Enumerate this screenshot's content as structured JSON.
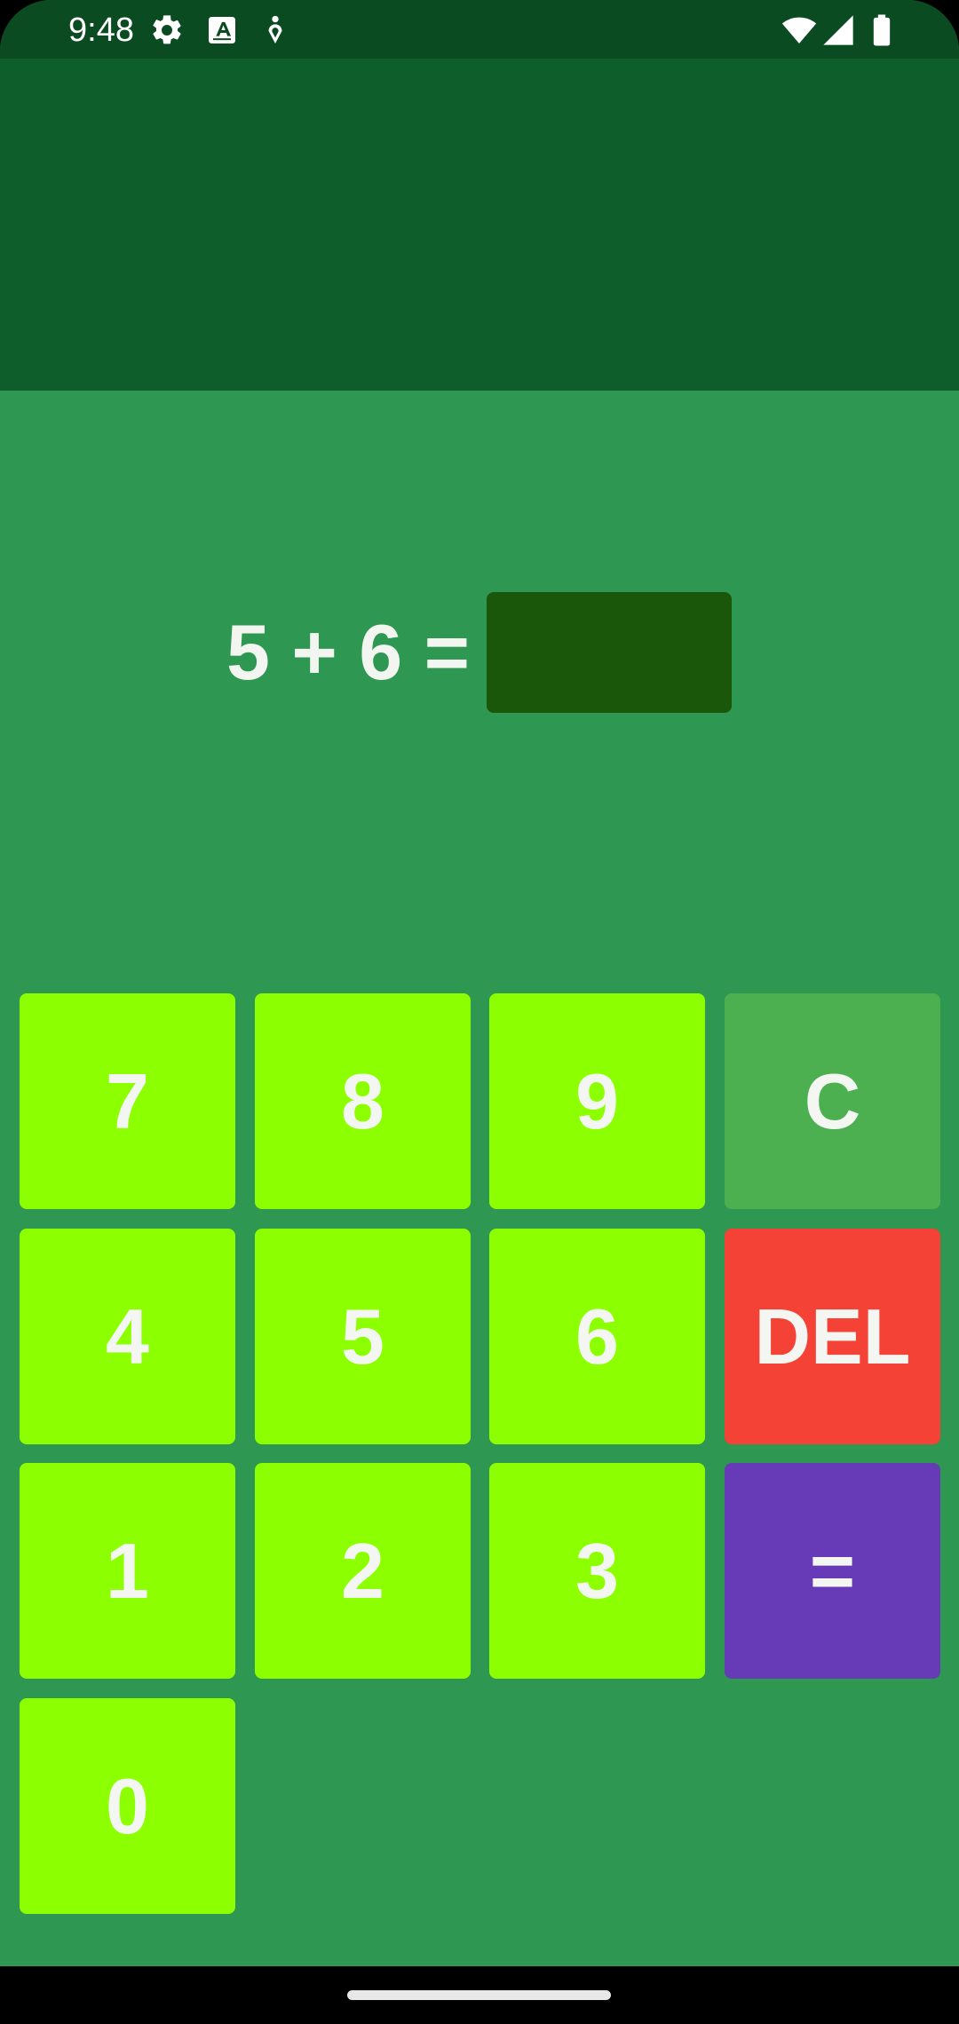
{
  "status_bar": {
    "time": "9:48",
    "icons": [
      "gear-icon",
      "text-a-icon",
      "accessibility-icon",
      "wifi-icon",
      "signal-icon",
      "battery-icon"
    ]
  },
  "colors": {
    "status_bar": "#0b4b22",
    "app_bar": "#0e5e2b",
    "background": "#2e9751",
    "answer_box": "#1a570b",
    "digit_key": "#8cff00",
    "clear_key": "#4caf50",
    "delete_key": "#f44336",
    "equals_key": "#673ab7"
  },
  "question": {
    "equation": "5 + 6 =",
    "answer_value": ""
  },
  "keypad": {
    "seven": "7",
    "eight": "8",
    "nine": "9",
    "clear": "C",
    "four": "4",
    "five": "5",
    "six": "6",
    "delete": "DEL",
    "one": "1",
    "two": "2",
    "three": "3",
    "equals": "=",
    "zero": "0"
  }
}
